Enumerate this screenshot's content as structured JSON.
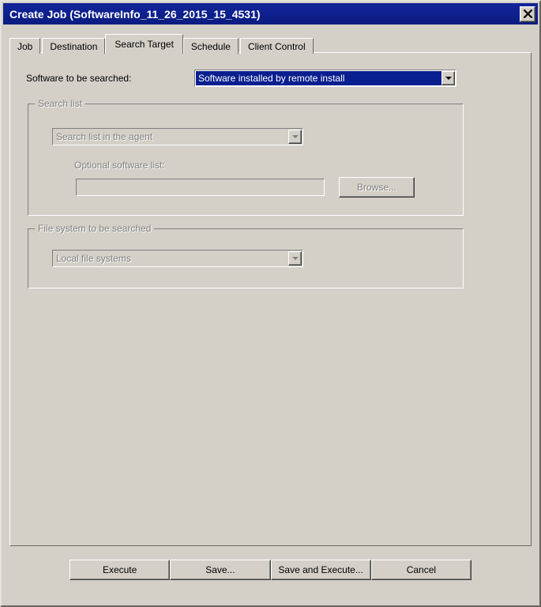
{
  "window": {
    "title": "Create Job (SoftwareInfo_11_26_2015_15_4531)",
    "close_label": "✕"
  },
  "tabs": [
    {
      "label": "Job",
      "active": false
    },
    {
      "label": "Destination",
      "active": false
    },
    {
      "label": "Search Target",
      "active": true
    },
    {
      "label": "Schedule",
      "active": false
    },
    {
      "label": "Client Control",
      "active": false
    }
  ],
  "search_target": {
    "software_label": "Software to be searched:",
    "software_value": "Software installed by remote install",
    "search_list_group": {
      "title": "Search list",
      "list_value": "Search list in the agent",
      "optional_label": "Optional software list:",
      "optional_value": "",
      "optional_placeholder": "",
      "browse_label": "Browse..."
    },
    "file_system_group": {
      "title": "File system to be searched",
      "value": "Local file systems"
    }
  },
  "buttons": [
    {
      "label": "Execute"
    },
    {
      "label": "Save..."
    },
    {
      "label": "Save and Execute..."
    },
    {
      "label": "Cancel"
    }
  ],
  "colors": {
    "dialog_face": "#d4d0c8",
    "titlebar": "#0a1f8f",
    "selection": "#0a1f8f",
    "disabled_text": "#808080"
  }
}
